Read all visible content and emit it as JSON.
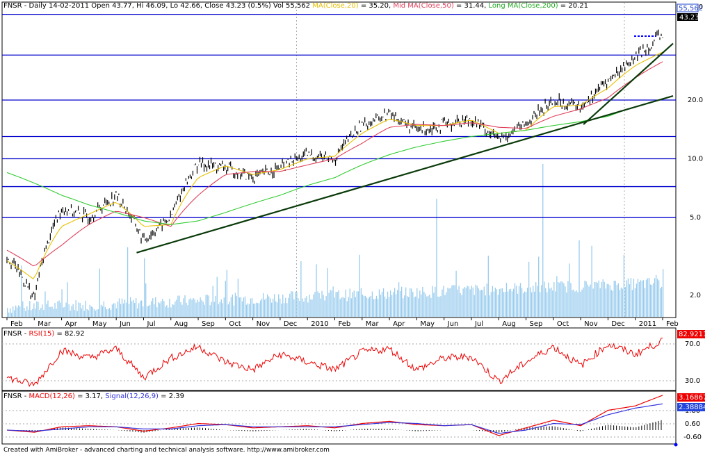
{
  "header": {
    "symbol": "FNSR",
    "info": " - Daily 14-02-2011 Open 43.77, Hi 46.09, Lo 42.66, Close 43.23 (0.5%) Vol 55,562 ",
    "ma_short": "MA(Close,20)",
    "ma_short_val": " = 35.20, ",
    "ma_mid": "Mid MA(Close,50)",
    "ma_mid_val": " = 31.44, ",
    "ma_long": "Long MA(Close,200)",
    "ma_long_val": " = 20.21"
  },
  "rsi_header": {
    "symbol": "FNSR",
    "sep": " - ",
    "name": "RSI(15)",
    "val": " = 82.92"
  },
  "macd_header": {
    "symbol": "FNSR",
    "sep": " - ",
    "macd": "MACD(12,26)",
    "macd_val": " = 3.17, ",
    "signal": "Signal(12,26,9)",
    "signal_val": " = 2.39"
  },
  "footer": "Created with AmiBroker - advanced charting and technical analysis software. http://www.amibroker.com",
  "badges": {
    "volume": "55,562",
    "close": "43.23",
    "rsi": "82.9211",
    "macd": "3.16867",
    "signal": "2.38884"
  },
  "colors": {
    "price": "#000000",
    "ma20": "#e8c000",
    "ma50": "#e0405a",
    "ma200": "#33cc33",
    "volume": "#99ccee",
    "hline": "#0000cc",
    "trend": "#0a3a0a",
    "rsi": "#ee0000",
    "macd": "#ee0000",
    "signal": "#3333dd",
    "grid": "#aaaaaa"
  },
  "chart_data": [
    {
      "type": "line",
      "title": "FNSR - Daily 14-02-2011",
      "scale": "log",
      "y_ticks": [
        "60.0",
        "20.0",
        "10.0",
        "5.0",
        "2.0"
      ],
      "x_ticks": [
        "Feb",
        "Mar",
        "Apr",
        "May",
        "Jun",
        "Jul",
        "Aug",
        "Sep",
        "Oct",
        "Nov",
        "Dec",
        "2010",
        "Feb",
        "Mar",
        "Apr",
        "May",
        "Jun",
        "Jul",
        "Aug",
        "Sep",
        "Oct",
        "Nov",
        "Dec",
        "2011",
        "Feb"
      ],
      "x": [
        "2009-02",
        "2009-03",
        "2009-04",
        "2009-05",
        "2009-06",
        "2009-07",
        "2009-08",
        "2009-09",
        "2009-10",
        "2009-11",
        "2009-12",
        "2010-01",
        "2010-02",
        "2010-03",
        "2010-04",
        "2010-05",
        "2010-06",
        "2010-07",
        "2010-08",
        "2010-09",
        "2010-10",
        "2010-11",
        "2010-12",
        "2011-01",
        "2011-02"
      ],
      "series": [
        {
          "name": "Close",
          "values": [
            3.2,
            1.9,
            5.6,
            5.0,
            6.5,
            3.8,
            5.0,
            9.5,
            9.0,
            8.0,
            9.0,
            10.5,
            10.0,
            15.0,
            17.0,
            14.0,
            15.0,
            16.0,
            12.5,
            15.0,
            20.0,
            18.5,
            25.0,
            33.0,
            43.23
          ]
        },
        {
          "name": "MA(Close,20)",
          "values": [
            3.0,
            2.4,
            4.5,
            5.2,
            6.0,
            4.5,
            4.6,
            8.0,
            9.2,
            8.3,
            8.8,
            10.0,
            10.3,
            13.5,
            16.0,
            14.8,
            14.8,
            15.8,
            13.5,
            14.0,
            18.5,
            18.8,
            23.0,
            30.0,
            35.2
          ]
        },
        {
          "name": "Mid MA(Close,50)",
          "values": [
            3.4,
            2.8,
            3.6,
            4.6,
            5.4,
            5.0,
            4.5,
            6.5,
            8.3,
            8.6,
            8.6,
            9.3,
            10.0,
            12.0,
            14.5,
            15.0,
            14.8,
            15.3,
            14.5,
            14.3,
            16.5,
            18.0,
            20.5,
            26.0,
            31.44
          ]
        },
        {
          "name": "Long MA(Close,200)",
          "values": [
            8.5,
            7.5,
            6.5,
            5.8,
            5.3,
            4.8,
            4.6,
            4.8,
            5.3,
            5.9,
            6.5,
            7.3,
            8.0,
            9.3,
            10.5,
            11.5,
            12.3,
            13.0,
            13.5,
            14.0,
            14.8,
            15.5,
            16.5,
            18.5,
            20.21
          ]
        }
      ],
      "horizontal_lines": [
        55.0,
        34.0,
        20.0,
        13.0,
        10.0,
        7.2,
        5.0
      ],
      "trendlines": [
        {
          "from": [
            "2009-07",
            3.3
          ],
          "to": [
            "2011-02",
            21.0
          ]
        },
        {
          "from": [
            "2010-11",
            15.0
          ],
          "to": [
            "2011-02",
            39.0
          ]
        }
      ],
      "last_volume": 55562,
      "last_close": 43.23
    },
    {
      "type": "line",
      "title": "FNSR - RSI(15) = 82.92",
      "y_ticks": [
        "70.0",
        "30.0"
      ],
      "series": [
        {
          "name": "RSI(15)",
          "values": [
            35,
            25,
            70,
            60,
            72,
            35,
            60,
            75,
            55,
            45,
            65,
            55,
            45,
            68,
            72,
            45,
            60,
            62,
            30,
            55,
            75,
            50,
            78,
            65,
            82.92
          ]
        }
      ]
    },
    {
      "type": "line",
      "title": "FNSR - MACD(12,26) = 3.17, Signal(12,26,9) = 2.39",
      "y_ticks": [
        "1.80",
        "0.60",
        "-0.60"
      ],
      "series": [
        {
          "name": "MACD(12,26)",
          "values": [
            0.0,
            -0.2,
            0.3,
            0.4,
            0.3,
            -0.1,
            0.2,
            0.6,
            0.5,
            0.2,
            0.3,
            0.4,
            0.2,
            0.6,
            0.8,
            0.5,
            0.4,
            0.5,
            -0.5,
            0.2,
            0.9,
            0.4,
            1.8,
            2.2,
            3.17
          ]
        },
        {
          "name": "Signal(12,26,9)",
          "values": [
            0.0,
            -0.1,
            0.1,
            0.3,
            0.3,
            0.1,
            0.1,
            0.4,
            0.5,
            0.3,
            0.3,
            0.3,
            0.3,
            0.5,
            0.7,
            0.6,
            0.4,
            0.5,
            -0.3,
            0.0,
            0.6,
            0.5,
            1.4,
            2.0,
            2.39
          ]
        }
      ],
      "last_macd": 3.16867,
      "last_signal": 2.38884
    }
  ]
}
